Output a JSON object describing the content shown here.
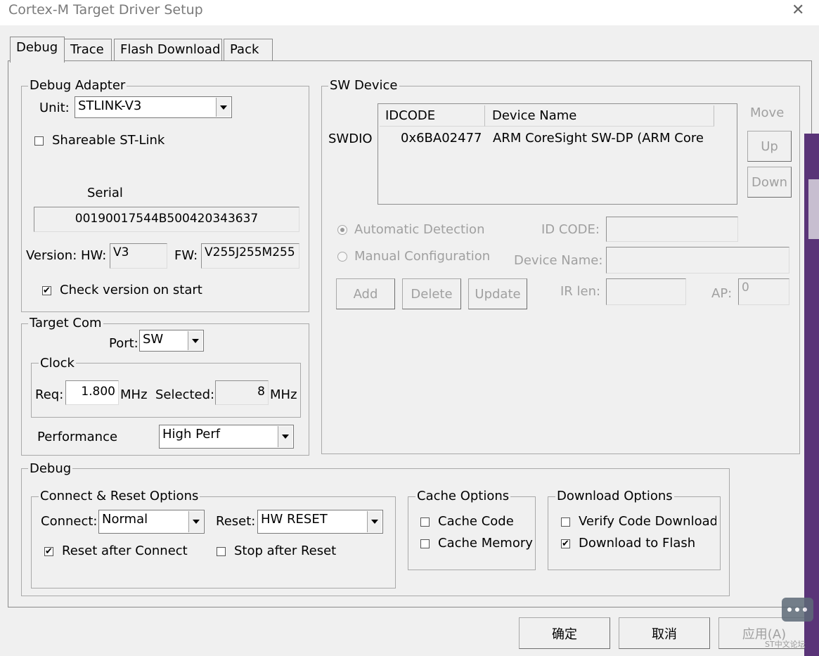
{
  "window": {
    "title": "Cortex-M Target Driver Setup",
    "close_symbol": "✕"
  },
  "tabs": [
    {
      "label": "Debug"
    },
    {
      "label": "Trace"
    },
    {
      "label": "Flash Download"
    },
    {
      "label": "Pack"
    }
  ],
  "debug_adapter": {
    "group_label": "Debug Adapter",
    "unit_label": "Unit:",
    "unit_value": "STLINK-V3",
    "shareable_label": "Shareable ST-Link",
    "shareable_checked": false,
    "serial_label": "Serial",
    "serial_value": "00190017544B500420343637",
    "version_label": "Version: HW:",
    "hw_value": "V3",
    "fw_label": "FW:",
    "fw_value": "V255J255M255",
    "check_version_label": "Check version on start",
    "check_version_checked": true
  },
  "target_com": {
    "group_label": "Target Com",
    "port_label": "Port:",
    "port_value": "SW",
    "clock_label": "Clock",
    "req_label": "Req:",
    "req_value": "1.800",
    "req_unit": "MHz",
    "selected_label": "Selected:",
    "selected_value": "8",
    "selected_unit": "MHz",
    "performance_label": "Performance",
    "performance_value": "High Perf"
  },
  "sw_device": {
    "group_label": "SW Device",
    "columns": [
      "IDCODE",
      "Device Name"
    ],
    "row_label": "SWDIO",
    "rows": [
      {
        "idcode": "0x6BA02477",
        "name": "ARM CoreSight SW-DP (ARM Core"
      }
    ],
    "move_label": "Move",
    "up_label": "Up",
    "down_label": "Down",
    "auto_label": "Automatic Detection",
    "manual_label": "Manual Configuration",
    "idcode_field_label": "ID CODE:",
    "device_name_label": "Device Name:",
    "add_label": "Add",
    "delete_label": "Delete",
    "update_label": "Update",
    "irlen_label": "IR len:",
    "ap_label": "AP:",
    "ap_value": "0"
  },
  "debug": {
    "group_label": "Debug",
    "connect_reset": {
      "group_label": "Connect & Reset Options",
      "connect_label": "Connect:",
      "connect_value": "Normal",
      "reset_label": "Reset:",
      "reset_value": "HW RESET",
      "reset_after_connect_label": "Reset after Connect",
      "reset_after_connect_checked": true,
      "stop_after_reset_label": "Stop after Reset",
      "stop_after_reset_checked": false
    },
    "cache": {
      "group_label": "Cache Options",
      "cache_code_label": "Cache Code",
      "cache_memory_label": "Cache Memory"
    },
    "download": {
      "group_label": "Download Options",
      "verify_label": "Verify Code Download",
      "verify_checked": false,
      "flash_label": "Download to Flash",
      "flash_checked": true
    }
  },
  "footer": {
    "ok_label": "确定",
    "cancel_label": "取消",
    "apply_label": "应用(A)",
    "watermark": "ST中文论坛"
  },
  "colors": {
    "side_bar": "#5a3478"
  }
}
